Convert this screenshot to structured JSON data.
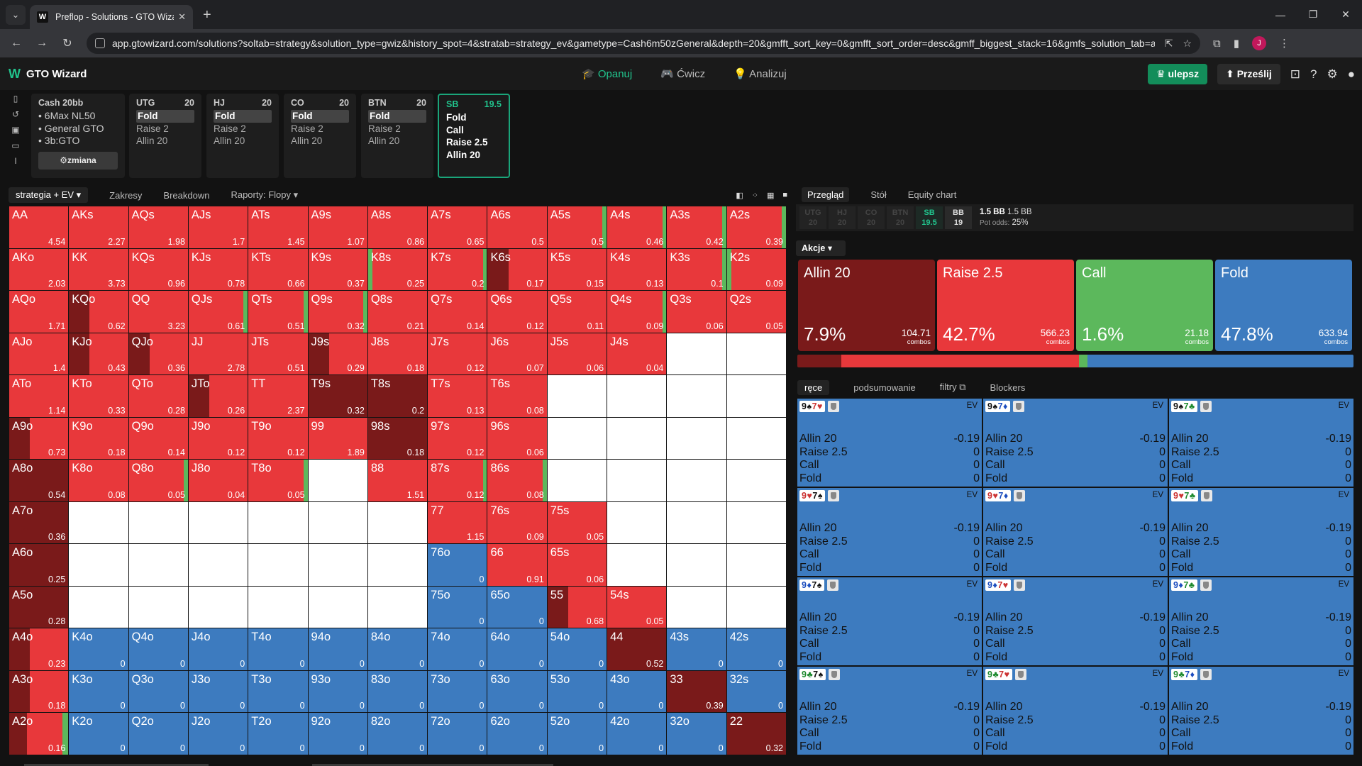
{
  "browser": {
    "tab_title": "Preflop - Solutions - GTO Wizard",
    "tab_favicon": "W",
    "url": "app.gtowizard.com/solutions?soltab=strategy&solution_type=gwiz&history_spot=4&stratab=strategy_ev&gametype=Cash6m50zGeneral&depth=20&gmfft_sort_key=0&gmfft_sort_order=desc&gmff_biggest_stack=16&gmfs_solution_tab=ai_s...",
    "profile_initial": "J"
  },
  "app": {
    "logo_text": "GTO Wizard",
    "nav": [
      "Opanuj",
      "Ćwicz",
      "Analizuj"
    ],
    "upgrade_label": "ulepsz",
    "send_label": "Prześlij"
  },
  "spot": {
    "cash": {
      "title": "Cash",
      "stack": "20bb",
      "lines": [
        "6Max NL50",
        "General GTO",
        "3b:GTO"
      ],
      "change_label": "zmiana"
    },
    "positions": [
      {
        "name": "UTG",
        "stack": "20",
        "actions": [
          "Fold",
          "Raise 2",
          "Allin 20"
        ],
        "selected": 0
      },
      {
        "name": "HJ",
        "stack": "20",
        "actions": [
          "Fold",
          "Raise 2",
          "Allin 20"
        ],
        "selected": 0
      },
      {
        "name": "CO",
        "stack": "20",
        "actions": [
          "Fold",
          "Raise 2",
          "Allin 20"
        ],
        "selected": 0
      },
      {
        "name": "BTN",
        "stack": "20",
        "actions": [
          "Fold",
          "Raise 2",
          "Allin 20"
        ],
        "selected": 0
      },
      {
        "name": "SB",
        "stack": "19.5",
        "actions": [
          "Fold",
          "Call",
          "Raise 2.5",
          "Allin 20"
        ],
        "selected": -1
      }
    ]
  },
  "toolbar": {
    "view_select": "strategia + EV",
    "tabs": [
      "Zakresy",
      "Breakdown",
      "Raporty: Flopy"
    ]
  },
  "colors": {
    "allin": "#7a1a1a",
    "raise": "#e8383b",
    "call": "#5cb85c",
    "fold": "#3d7bbf",
    "empty": "#ffffff",
    "accent": "#21c48d"
  },
  "matrix": [
    [
      [
        "AA",
        "4.54",
        "R"
      ],
      [
        "AKs",
        "2.27",
        "R"
      ],
      [
        "AQs",
        "1.98",
        "R"
      ],
      [
        "AJs",
        "1.7",
        "R"
      ],
      [
        "ATs",
        "1.45",
        "R"
      ],
      [
        "A9s",
        "1.07",
        "R"
      ],
      [
        "A8s",
        "0.86",
        "R"
      ],
      [
        "A7s",
        "0.65",
        "R"
      ],
      [
        "A6s",
        "0.5",
        "R"
      ],
      [
        "A5s",
        "0.5",
        "RC"
      ],
      [
        "A4s",
        "0.46",
        "RC"
      ],
      [
        "A3s",
        "0.42",
        "RC"
      ],
      [
        "A2s",
        "0.39",
        "RC"
      ]
    ],
    [
      [
        "AKo",
        "2.03",
        "R"
      ],
      [
        "KK",
        "3.73",
        "R"
      ],
      [
        "KQs",
        "0.96",
        "R"
      ],
      [
        "KJs",
        "0.78",
        "R"
      ],
      [
        "KTs",
        "0.66",
        "R"
      ],
      [
        "K9s",
        "0.37",
        "R"
      ],
      [
        "K8s",
        "0.25",
        "CR"
      ],
      [
        "K7s",
        "0.2",
        "RC"
      ],
      [
        "K6s",
        "0.17",
        "AR"
      ],
      [
        "K5s",
        "0.15",
        "R"
      ],
      [
        "K4s",
        "0.13",
        "R"
      ],
      [
        "K3s",
        "0.1",
        "RC"
      ],
      [
        "K2s",
        "0.09",
        "CR"
      ]
    ],
    [
      [
        "AQo",
        "1.71",
        "R"
      ],
      [
        "KQo",
        "0.62",
        "AR"
      ],
      [
        "QQ",
        "3.23",
        "R"
      ],
      [
        "QJs",
        "0.61",
        "RC"
      ],
      [
        "QTs",
        "0.51",
        "RC"
      ],
      [
        "Q9s",
        "0.32",
        "RC"
      ],
      [
        "Q8s",
        "0.21",
        "R"
      ],
      [
        "Q7s",
        "0.14",
        "R"
      ],
      [
        "Q6s",
        "0.12",
        "R"
      ],
      [
        "Q5s",
        "0.11",
        "R"
      ],
      [
        "Q4s",
        "0.09",
        "RC"
      ],
      [
        "Q3s",
        "0.06",
        "R"
      ],
      [
        "Q2s",
        "0.05",
        "R"
      ]
    ],
    [
      [
        "AJo",
        "1.4",
        "R"
      ],
      [
        "KJo",
        "0.43",
        "AR"
      ],
      [
        "QJo",
        "0.36",
        "AR"
      ],
      [
        "JJ",
        "2.78",
        "R"
      ],
      [
        "JTs",
        "0.51",
        "R"
      ],
      [
        "J9s",
        "0.29",
        "AR"
      ],
      [
        "J8s",
        "0.18",
        "R"
      ],
      [
        "J7s",
        "0.12",
        "R"
      ],
      [
        "J6s",
        "0.07",
        "R"
      ],
      [
        "J5s",
        "0.06",
        "R"
      ],
      [
        "J4s",
        "0.04",
        "R"
      ],
      [
        "",
        "",
        "W"
      ],
      [
        "",
        "",
        "W"
      ]
    ],
    [
      [
        "ATo",
        "1.14",
        "R"
      ],
      [
        "KTo",
        "0.33",
        "R"
      ],
      [
        "QTo",
        "0.28",
        "R"
      ],
      [
        "JTo",
        "0.26",
        "AR"
      ],
      [
        "TT",
        "2.37",
        "R"
      ],
      [
        "T9s",
        "0.32",
        "A"
      ],
      [
        "T8s",
        "0.2",
        "A"
      ],
      [
        "T7s",
        "0.13",
        "R"
      ],
      [
        "T6s",
        "0.08",
        "R"
      ],
      [
        "",
        "",
        "W"
      ],
      [
        "",
        "",
        "W"
      ],
      [
        "",
        "",
        "W"
      ],
      [
        "",
        "",
        "W"
      ]
    ],
    [
      [
        "A9o",
        "0.73",
        "AR"
      ],
      [
        "K9o",
        "0.18",
        "R"
      ],
      [
        "Q9o",
        "0.14",
        "R"
      ],
      [
        "J9o",
        "0.12",
        "R"
      ],
      [
        "T9o",
        "0.12",
        "R"
      ],
      [
        "99",
        "1.89",
        "R"
      ],
      [
        "98s",
        "0.18",
        "A"
      ],
      [
        "97s",
        "0.12",
        "R"
      ],
      [
        "96s",
        "0.06",
        "R"
      ],
      [
        "",
        "",
        "W"
      ],
      [
        "",
        "",
        "W"
      ],
      [
        "",
        "",
        "W"
      ],
      [
        "",
        "",
        "W"
      ]
    ],
    [
      [
        "A8o",
        "0.54",
        "A"
      ],
      [
        "K8o",
        "0.08",
        "R"
      ],
      [
        "Q8o",
        "0.05",
        "RC"
      ],
      [
        "J8o",
        "0.04",
        "R"
      ],
      [
        "T8o",
        "0.05",
        "RC"
      ],
      [
        "",
        "",
        "W"
      ],
      [
        "88",
        "1.51",
        "R"
      ],
      [
        "87s",
        "0.12",
        "RC"
      ],
      [
        "86s",
        "0.08",
        "RC"
      ],
      [
        "",
        "",
        "W"
      ],
      [
        "",
        "",
        "W"
      ],
      [
        "",
        "",
        "W"
      ],
      [
        "",
        "",
        "W"
      ]
    ],
    [
      [
        "A7o",
        "0.36",
        "A"
      ],
      [
        "",
        "",
        "W"
      ],
      [
        "",
        "",
        "W"
      ],
      [
        "",
        "",
        "W"
      ],
      [
        "",
        "",
        "W"
      ],
      [
        "",
        "",
        "W"
      ],
      [
        "",
        "",
        "W"
      ],
      [
        "77",
        "1.15",
        "R"
      ],
      [
        "76s",
        "0.09",
        "R"
      ],
      [
        "75s",
        "0.05",
        "R"
      ],
      [
        "",
        "",
        "W"
      ],
      [
        "",
        "",
        "W"
      ],
      [
        "",
        "",
        "W"
      ]
    ],
    [
      [
        "A6o",
        "0.25",
        "A"
      ],
      [
        "",
        "",
        "W"
      ],
      [
        "",
        "",
        "W"
      ],
      [
        "",
        "",
        "W"
      ],
      [
        "",
        "",
        "W"
      ],
      [
        "",
        "",
        "W"
      ],
      [
        "",
        "",
        "W"
      ],
      [
        "76o",
        "0",
        "F"
      ],
      [
        "66",
        "0.91",
        "R"
      ],
      [
        "65s",
        "0.06",
        "R"
      ],
      [
        "",
        "",
        "W"
      ],
      [
        "",
        "",
        "W"
      ],
      [
        "",
        "",
        "W"
      ]
    ],
    [
      [
        "A5o",
        "0.28",
        "A"
      ],
      [
        "",
        "",
        "W"
      ],
      [
        "",
        "",
        "W"
      ],
      [
        "",
        "",
        "W"
      ],
      [
        "",
        "",
        "W"
      ],
      [
        "",
        "",
        "W"
      ],
      [
        "",
        "",
        "W"
      ],
      [
        "75o",
        "0",
        "F"
      ],
      [
        "65o",
        "0",
        "F"
      ],
      [
        "55",
        "0.68",
        "AR"
      ],
      [
        "54s",
        "0.05",
        "R"
      ],
      [
        "",
        "",
        "W"
      ],
      [
        "",
        "",
        "W"
      ]
    ],
    [
      [
        "A4o",
        "0.23",
        "AR"
      ],
      [
        "K4o",
        "0",
        "F"
      ],
      [
        "Q4o",
        "0",
        "F"
      ],
      [
        "J4o",
        "0",
        "F"
      ],
      [
        "T4o",
        "0",
        "F"
      ],
      [
        "94o",
        "0",
        "F"
      ],
      [
        "84o",
        "0",
        "F"
      ],
      [
        "74o",
        "0",
        "F"
      ],
      [
        "64o",
        "0",
        "F"
      ],
      [
        "54o",
        "0",
        "F"
      ],
      [
        "44",
        "0.52",
        "A"
      ],
      [
        "43s",
        "0",
        "F"
      ],
      [
        "42s",
        "0",
        "F"
      ]
    ],
    [
      [
        "A3o",
        "0.18",
        "AR"
      ],
      [
        "K3o",
        "0",
        "F"
      ],
      [
        "Q3o",
        "0",
        "F"
      ],
      [
        "J3o",
        "0",
        "F"
      ],
      [
        "T3o",
        "0",
        "F"
      ],
      [
        "93o",
        "0",
        "F"
      ],
      [
        "83o",
        "0",
        "F"
      ],
      [
        "73o",
        "0",
        "F"
      ],
      [
        "63o",
        "0",
        "F"
      ],
      [
        "53o",
        "0",
        "F"
      ],
      [
        "43o",
        "0",
        "F"
      ],
      [
        "33",
        "0.39",
        "A"
      ],
      [
        "32s",
        "0",
        "F"
      ]
    ],
    [
      [
        "A2o",
        "0.16",
        "ARC"
      ],
      [
        "K2o",
        "0",
        "F"
      ],
      [
        "Q2o",
        "0",
        "F"
      ],
      [
        "J2o",
        "0",
        "F"
      ],
      [
        "T2o",
        "0",
        "F"
      ],
      [
        "92o",
        "0",
        "F"
      ],
      [
        "82o",
        "0",
        "F"
      ],
      [
        "72o",
        "0",
        "F"
      ],
      [
        "62o",
        "0",
        "F"
      ],
      [
        "52o",
        "0",
        "F"
      ],
      [
        "42o",
        "0",
        "F"
      ],
      [
        "32o",
        "0",
        "F"
      ],
      [
        "22",
        "0.32",
        "A"
      ]
    ]
  ],
  "right": {
    "tabs": [
      "Przegląd",
      "Stół",
      "Equity chart"
    ],
    "positions": [
      [
        "UTG",
        "20"
      ],
      [
        "HJ",
        "20"
      ],
      [
        "CO",
        "20"
      ],
      [
        "BTN",
        "20"
      ],
      [
        "SB",
        "19.5"
      ],
      [
        "BB",
        "19"
      ]
    ],
    "pot": {
      "a": "1.5 BB",
      "b": "1.5 BB",
      "odds_label": "Pot odds:",
      "odds": "25%"
    },
    "actions_dropdown": "Akcje",
    "actions": [
      {
        "name": "Allin 20",
        "pct": "7.9%",
        "combos": "104.71",
        "combos_label": "combos",
        "color": "#7a1a1a",
        "freq": 7.9
      },
      {
        "name": "Raise 2.5",
        "pct": "42.7%",
        "combos": "566.23",
        "combos_label": "combos",
        "color": "#e8383b",
        "freq": 42.7
      },
      {
        "name": "Call",
        "pct": "1.6%",
        "combos": "21.18",
        "combos_label": "combos",
        "color": "#5cb85c",
        "freq": 1.6
      },
      {
        "name": "Fold",
        "pct": "47.8%",
        "combos": "633.94",
        "combos_label": "combos",
        "color": "#3d7bbf",
        "freq": 47.8
      }
    ],
    "hand_tabs": [
      "ręce",
      "podsumowanie",
      "filtry",
      "Blockers"
    ],
    "ev_label": "EV",
    "hands": [
      {
        "c1": "9♠",
        "c2": "7♥",
        "s1": "black",
        "s2": "red"
      },
      {
        "c1": "9♠",
        "c2": "7♦",
        "s1": "black",
        "s2": "blue"
      },
      {
        "c1": "9♠",
        "c2": "7♣",
        "s1": "black",
        "s2": "green"
      },
      {
        "c1": "9♥",
        "c2": "7♠",
        "s1": "red",
        "s2": "black"
      },
      {
        "c1": "9♥",
        "c2": "7♦",
        "s1": "red",
        "s2": "blue"
      },
      {
        "c1": "9♥",
        "c2": "7♣",
        "s1": "red",
        "s2": "green"
      },
      {
        "c1": "9♦",
        "c2": "7♠",
        "s1": "blue",
        "s2": "black"
      },
      {
        "c1": "9♦",
        "c2": "7♥",
        "s1": "blue",
        "s2": "red"
      },
      {
        "c1": "9♦",
        "c2": "7♣",
        "s1": "blue",
        "s2": "green"
      },
      {
        "c1": "9♣",
        "c2": "7♠",
        "s1": "green",
        "s2": "black"
      },
      {
        "c1": "9♣",
        "c2": "7♥",
        "s1": "green",
        "s2": "red"
      },
      {
        "c1": "9♣",
        "c2": "7♦",
        "s1": "green",
        "s2": "blue"
      }
    ],
    "hand_rows": [
      [
        "Allin 20",
        "-0.19"
      ],
      [
        "Raise 2.5",
        "0"
      ],
      [
        "Call",
        "0"
      ],
      [
        "Fold",
        "0"
      ]
    ]
  }
}
